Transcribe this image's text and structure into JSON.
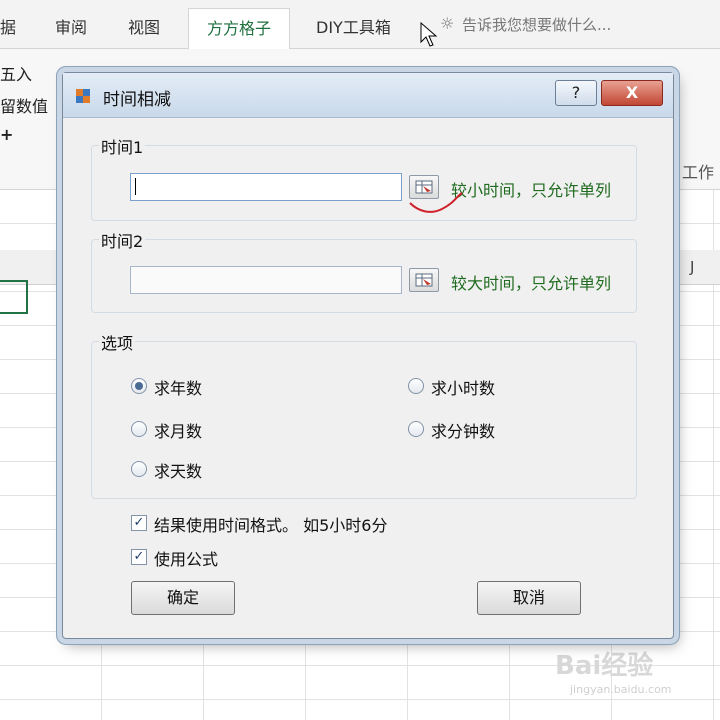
{
  "ribbon": {
    "tabs": [
      {
        "label": "据"
      },
      {
        "label": "审阅"
      },
      {
        "label": "视图"
      },
      {
        "label": "方方格子"
      },
      {
        "label": "DIY工具箱"
      }
    ],
    "tell_me": "告诉我您想要做什么...",
    "left_labels": [
      "五入",
      "留数值"
    ],
    "right_label": "工作"
  },
  "sheet": {
    "column_label": "J"
  },
  "dialog": {
    "title": "时间相减",
    "help_label": "?",
    "close_label": "X",
    "time1": {
      "label": "时间1",
      "value": "",
      "hint": "较小时间，只允许单列"
    },
    "time2": {
      "label": "时间2",
      "value": "",
      "hint": "较大时间，只允许单列"
    },
    "options": {
      "label": "选项",
      "items": [
        {
          "label": "求年数",
          "checked": true
        },
        {
          "label": "求月数",
          "checked": false
        },
        {
          "label": "求天数",
          "checked": false
        },
        {
          "label": "求小时数",
          "checked": false
        },
        {
          "label": "求分钟数",
          "checked": false
        }
      ]
    },
    "checkbox_time_format": {
      "label": "结果使用时间格式。 如5小时6分",
      "checked": true
    },
    "checkbox_formula": {
      "label": "使用公式",
      "checked": true
    },
    "ok_label": "确定",
    "cancel_label": "取消"
  },
  "watermark": {
    "text": "Bai经验",
    "sub": "jingyan.baidu.com"
  },
  "colors": {
    "hint_green": "#1f6b1f",
    "accent": "#217346",
    "close_red": "#c24634"
  }
}
